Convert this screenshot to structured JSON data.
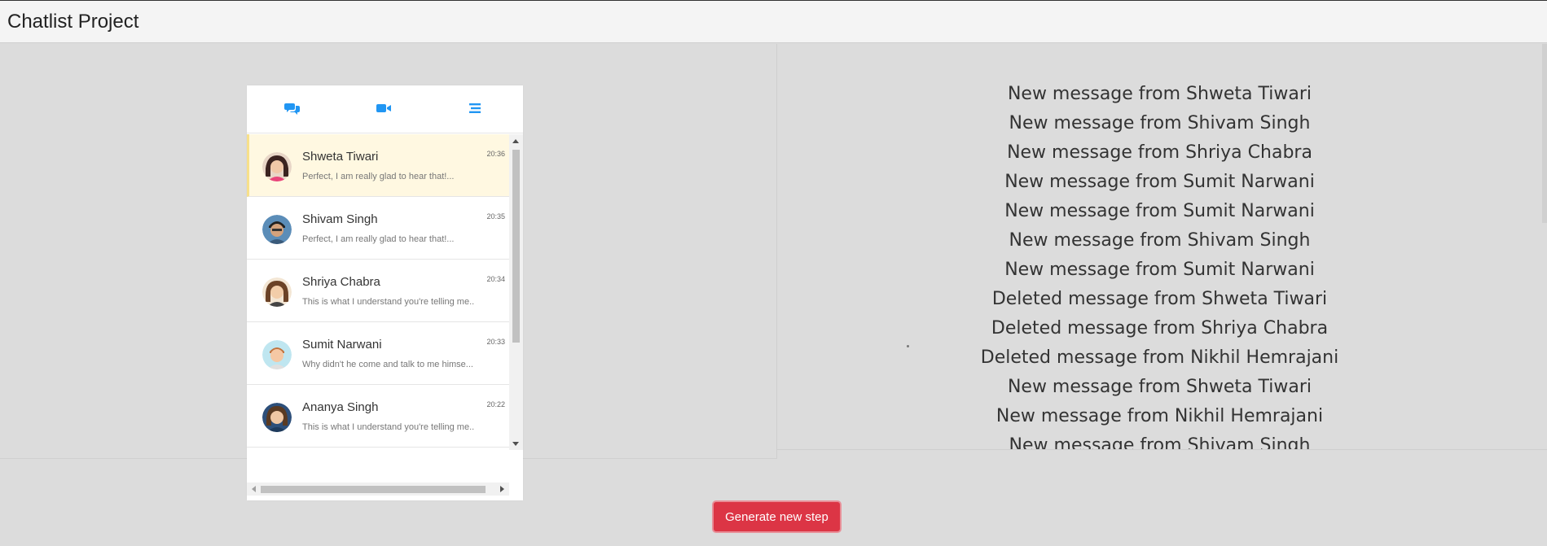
{
  "header": {
    "title": "Chatlist Project"
  },
  "tabs": [
    {
      "icon": "chat-bubbles-icon",
      "color": "#2196f3"
    },
    {
      "icon": "video-camera-icon",
      "color": "#2196f3"
    },
    {
      "icon": "hamburger-menu-icon",
      "color": "#2196f3"
    }
  ],
  "chats": [
    {
      "name": "Shweta Tiwari",
      "time": "20:36",
      "preview": "Perfect, I am really glad to hear that!...",
      "active": true
    },
    {
      "name": "Shivam Singh",
      "time": "20:35",
      "preview": "Perfect, I am really glad to hear that!...",
      "active": false
    },
    {
      "name": "Shriya Chabra",
      "time": "20:34",
      "preview": "This is what I understand you're telling me..",
      "active": false
    },
    {
      "name": "Sumit Narwani",
      "time": "20:33",
      "preview": "Why didn't he come and talk to me himse...",
      "active": false
    },
    {
      "name": "Ananya Singh",
      "time": "20:22",
      "preview": "This is what I understand you're telling me..",
      "active": false
    }
  ],
  "feed": [
    "New message from Shweta Tiwari",
    "New message from Shivam Singh",
    "New message from Shriya Chabra",
    "New message from Sumit Narwani",
    "New message from Sumit Narwani",
    "New message from Shivam Singh",
    "New message from Sumit Narwani",
    "Deleted message from Shweta Tiwari",
    "Deleted message from Shriya Chabra",
    "Deleted message from Nikhil Hemrajani",
    "New message from Shweta Tiwari",
    "New message from Nikhil Hemrajani",
    "New message from Shivam Singh"
  ],
  "actions": {
    "generate_label": "Generate new step",
    "color": "#dc3545"
  }
}
